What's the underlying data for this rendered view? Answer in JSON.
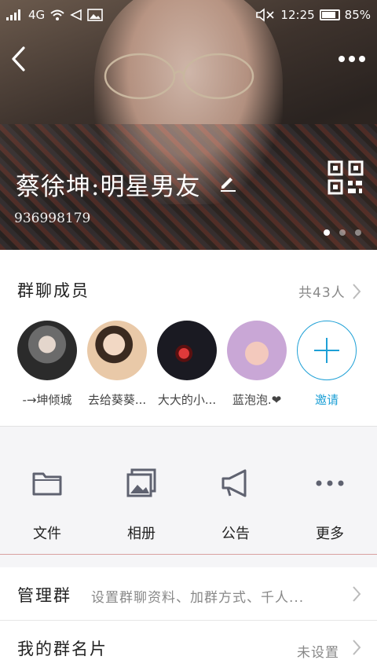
{
  "status_bar": {
    "network": "4G",
    "time": "12:25",
    "battery": "85%",
    "icons": [
      "signal-icon",
      "wifi-icon",
      "navigation-icon",
      "image-icon",
      "mute-icon",
      "battery-icon"
    ]
  },
  "header": {
    "group_name": "蔡徐坤:明星男友",
    "group_id": "936998179",
    "icons": [
      "back-icon",
      "more-icon",
      "edit-icon",
      "qr-code-icon"
    ],
    "carousel_pages": 3,
    "carousel_active": 1
  },
  "members": {
    "title": "群聊成员",
    "count": "共43人",
    "list": [
      {
        "name": "-→坤倾城"
      },
      {
        "name": "去给葵葵..."
      },
      {
        "name": "大大的小..."
      },
      {
        "name": "蓝泡泡.❤"
      }
    ],
    "invite_label": "邀请"
  },
  "actions": [
    {
      "label": "文件",
      "icon": "folder-icon"
    },
    {
      "label": "相册",
      "icon": "album-icon"
    },
    {
      "label": "公告",
      "icon": "megaphone-icon"
    },
    {
      "label": "更多",
      "icon": "more-dots-icon"
    }
  ],
  "rows": [
    {
      "title": "管理群",
      "desc": "设置群聊资料、加群方式、千人..."
    },
    {
      "title": "我的群名片",
      "value": "未设置"
    }
  ],
  "colors": {
    "accent": "#1ea0d6",
    "icon_gray": "#5f6270",
    "divider_red": "#d8a0a0"
  }
}
